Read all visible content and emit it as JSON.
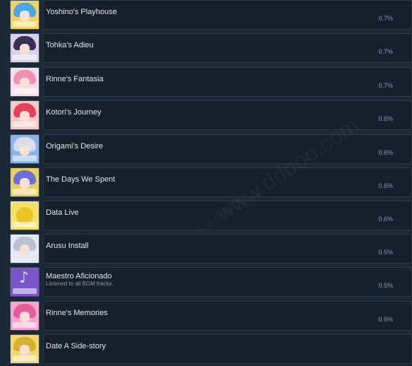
{
  "achievements": [
    {
      "name": "Yoshino's Playhouse",
      "percent": "0.7%",
      "icon": "yoshino-icon",
      "hair": "#4aa6e8",
      "bg": "#f3d35a"
    },
    {
      "name": "Tohka's Adieu",
      "percent": "0.7%",
      "icon": "tohka-icon",
      "hair": "#3a2f56",
      "bg": "#d8d0e8"
    },
    {
      "name": "Rinne's Fantasia",
      "percent": "0.7%",
      "icon": "rinne-icon",
      "hair": "#f08fb0",
      "bg": "#f6dde8"
    },
    {
      "name": "Kotori's Journey",
      "percent": "0.6%",
      "icon": "kotori-icon",
      "hair": "#e8405a",
      "bg": "#f8c8c8"
    },
    {
      "name": "Origami's Desire",
      "percent": "0.6%",
      "icon": "origami-icon",
      "hair": "#d8dcec",
      "bg": "#8ab4e8"
    },
    {
      "name": "The Days We Spent",
      "percent": "0.6%",
      "icon": "days-icon",
      "hair": "#6a70d8",
      "bg": "#e8d060"
    },
    {
      "name": "Data Live",
      "percent": "0.6%",
      "icon": "data-live-icon",
      "hair": "#e8c820",
      "bg": "#f5e06a"
    },
    {
      "name": "Arusu Install",
      "percent": "0.5%",
      "icon": "arusu-icon",
      "hair": "#b8c0d4",
      "bg": "#e6e9f2"
    },
    {
      "name": "Maestro Aficionado",
      "description": "Listened to all BGM tracks.",
      "percent": "0.5%",
      "icon": "music-note-icon",
      "hair": "#6a3fb0",
      "bg": "#7a54c8"
    },
    {
      "name": "Rinne's Memories",
      "percent": "0.5%",
      "icon": "rinne-memories-icon",
      "hair": "#e85aa0",
      "bg": "#f4a6cc"
    },
    {
      "name": "Date A Side-story",
      "percent": "",
      "icon": "side-story-icon",
      "hair": "#d6b030",
      "bg": "#f0d878"
    }
  ],
  "watermark": "www.ddooo.com",
  "watermark_cn": "多多软件站"
}
